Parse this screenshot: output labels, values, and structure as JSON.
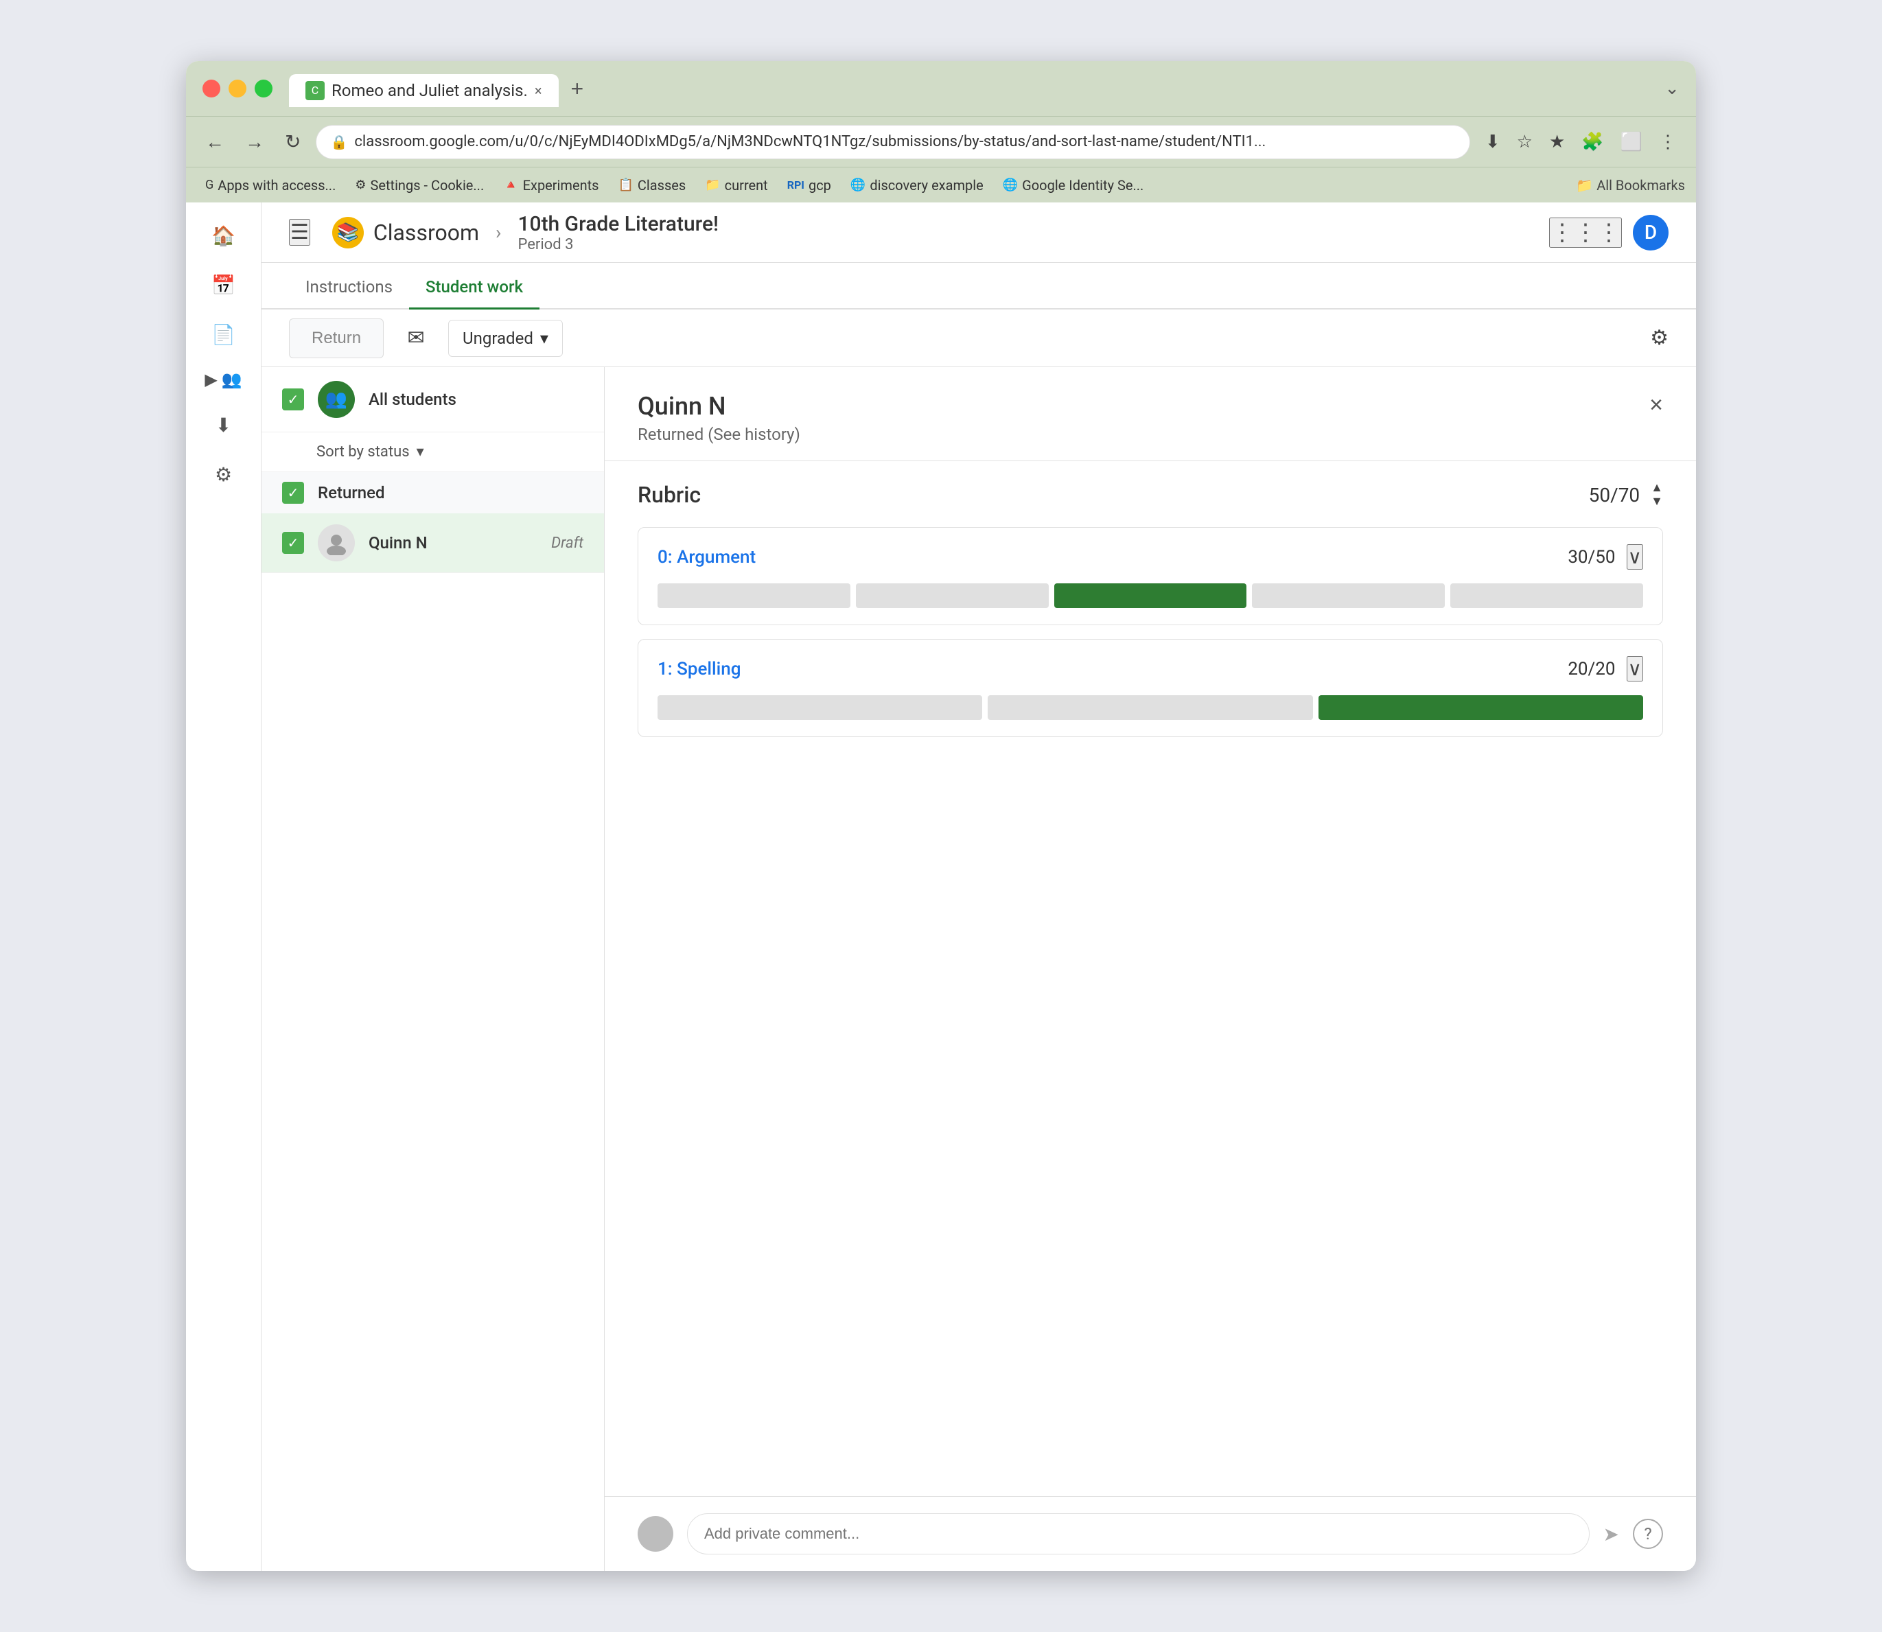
{
  "browser": {
    "tab_title": "Romeo and Juliet analysis.",
    "url": "classroom.google.com/u/0/c/NjEyMDI4ODIxMDg5/a/NjM3NDcwNTQ1NTgz/submissions/by-status/and-sort-last-name/student/NTI1...",
    "tab_close": "×",
    "tab_new": "+",
    "chevron": "⌄"
  },
  "bookmarks": [
    {
      "id": "apps",
      "icon": "G",
      "label": "Apps with access..."
    },
    {
      "id": "settings",
      "icon": "⚙",
      "label": "Settings - Cookie..."
    },
    {
      "id": "experiments",
      "icon": "🔺",
      "label": "Experiments"
    },
    {
      "id": "classes",
      "icon": "📋",
      "label": "Classes"
    },
    {
      "id": "current",
      "icon": "📁",
      "label": "current"
    },
    {
      "id": "rpi",
      "icon": "RPI",
      "label": "gcp"
    },
    {
      "id": "discovery",
      "icon": "🌐",
      "label": "discovery example"
    },
    {
      "id": "google-identity",
      "icon": "🌐",
      "label": "Google Identity Se..."
    }
  ],
  "bookmarks_right": "📁 All Bookmarks",
  "header": {
    "menu_icon": "☰",
    "logo_letter": "C",
    "app_name": "Classroom",
    "breadcrumb_arrow": "›",
    "course_name": "10th Grade Literature!",
    "course_period": "Period 3",
    "user_initial": "D"
  },
  "tabs": [
    {
      "id": "instructions",
      "label": "Instructions",
      "active": false
    },
    {
      "id": "student-work",
      "label": "Student work",
      "active": true
    }
  ],
  "toolbar": {
    "return_label": "Return",
    "grade_label": "Ungraded",
    "grade_arrow": "▾"
  },
  "left_panel": {
    "all_students_label": "All students",
    "sort_label": "Sort by status",
    "sort_arrow": "▾",
    "section_label": "Returned",
    "student_name": "Quinn N",
    "student_status": "Draft"
  },
  "right_panel": {
    "student_name": "Quinn N",
    "student_status": "Returned (See history)",
    "rubric_title": "Rubric",
    "rubric_score": "50/70",
    "criteria": [
      {
        "id": "argument",
        "label": "0: Argument",
        "score": "30/50",
        "segments": [
          false,
          false,
          true,
          false,
          false
        ],
        "active_index": 2
      },
      {
        "id": "spelling",
        "label": "1: Spelling",
        "score": "20/20",
        "segments": [
          false,
          false,
          true
        ],
        "active_index": 2
      }
    ],
    "comment_placeholder": "Add private comment...",
    "send_icon": "➤",
    "help_icon": "?"
  }
}
